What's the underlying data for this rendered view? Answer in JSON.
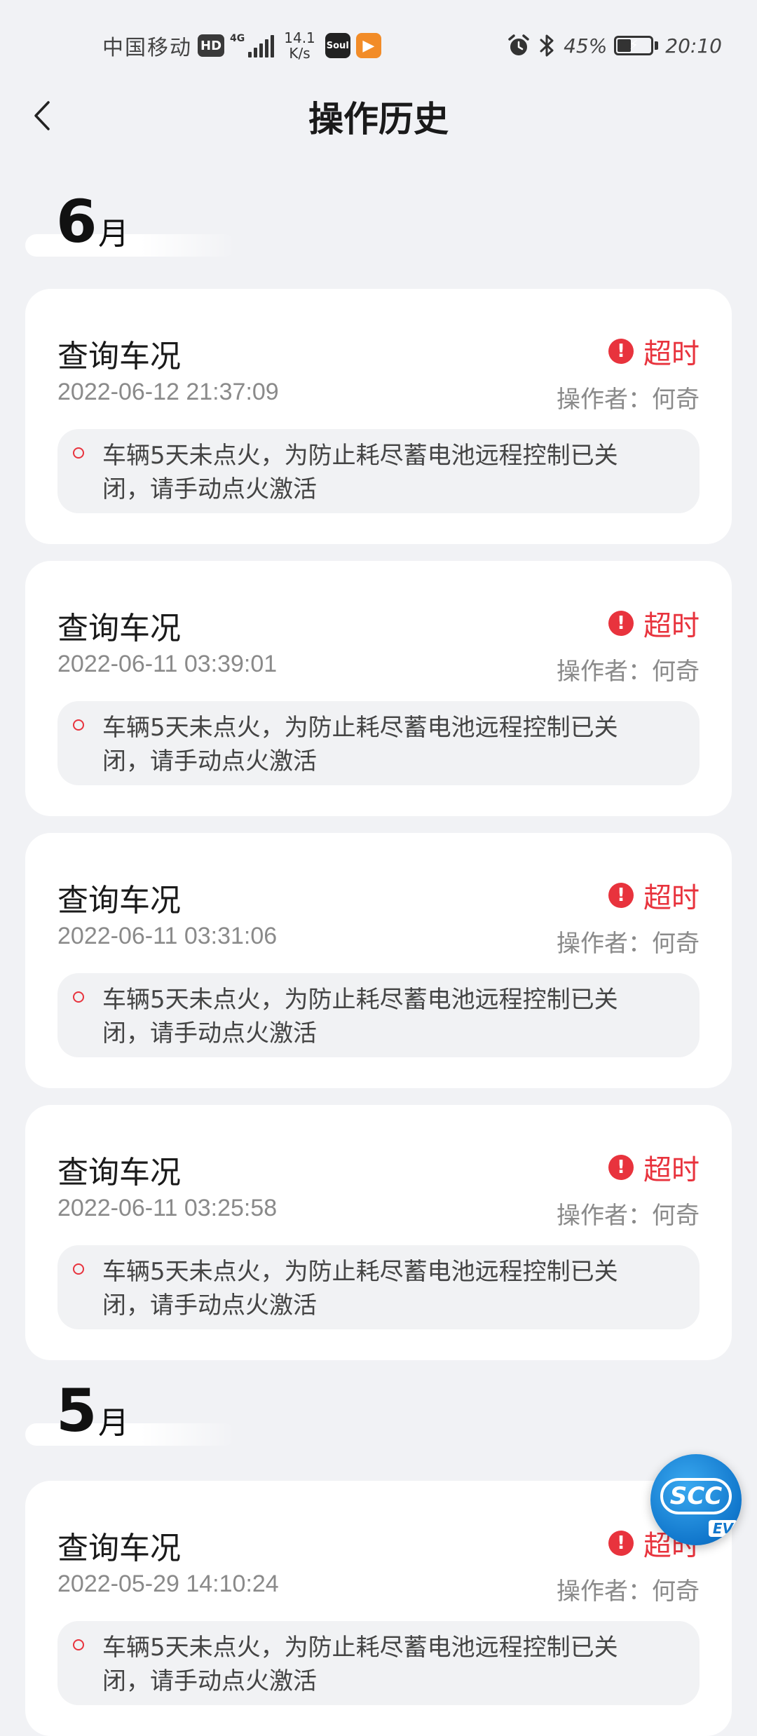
{
  "status_bar": {
    "carrier": "中国移动",
    "hd_badge": "HD",
    "network": "4G",
    "speed_value": "14.1",
    "speed_unit": "K/s",
    "app1_label": "Soul",
    "app2_label": "▶",
    "battery_percent": "45%",
    "battery_level": 0.45,
    "time": "20:10",
    "icons": [
      "alarm-icon",
      "bluetooth-icon",
      "battery-icon"
    ]
  },
  "header": {
    "back_icon": "chevron-left-icon",
    "title": "操作历史"
  },
  "months": [
    {
      "num": "6",
      "unit": "月"
    },
    {
      "num": "5",
      "unit": "月"
    }
  ],
  "records": [
    {
      "name": "查询车况",
      "time": "2022-06-12 21:37:09",
      "status": "超时",
      "operator": "操作者：何奇",
      "message": "车辆5天未点火，为防止耗尽蓄电池远程控制已关闭，请手动点火激活"
    },
    {
      "name": "查询车况",
      "time": "2022-06-11 03:39:01",
      "status": "超时",
      "operator": "操作者：何奇",
      "message": "车辆5天未点火，为防止耗尽蓄电池远程控制已关闭，请手动点火激活"
    },
    {
      "name": "查询车况",
      "time": "2022-06-11 03:31:06",
      "status": "超时",
      "operator": "操作者：何奇",
      "message": "车辆5天未点火，为防止耗尽蓄电池远程控制已关闭，请手动点火激活"
    },
    {
      "name": "查询车况",
      "time": "2022-06-11 03:25:58",
      "status": "超时",
      "operator": "操作者：何奇",
      "message": "车辆5天未点火，为防止耗尽蓄电池远程控制已关闭，请手动点火激活"
    },
    {
      "name": "查询车况",
      "time": "2022-05-29 14:10:24",
      "status": "超时",
      "operator": "操作者：何奇",
      "message": "车辆5天未点火，为防止耗尽蓄电池远程控制已关闭，请手动点火激活"
    }
  ],
  "float_logo": {
    "text": "SCC",
    "badge": "EV"
  },
  "colors": {
    "accent_red": "#e8333d",
    "background": "#f1f2f5",
    "card": "#ffffff",
    "logo_blue": "#1177cc"
  }
}
